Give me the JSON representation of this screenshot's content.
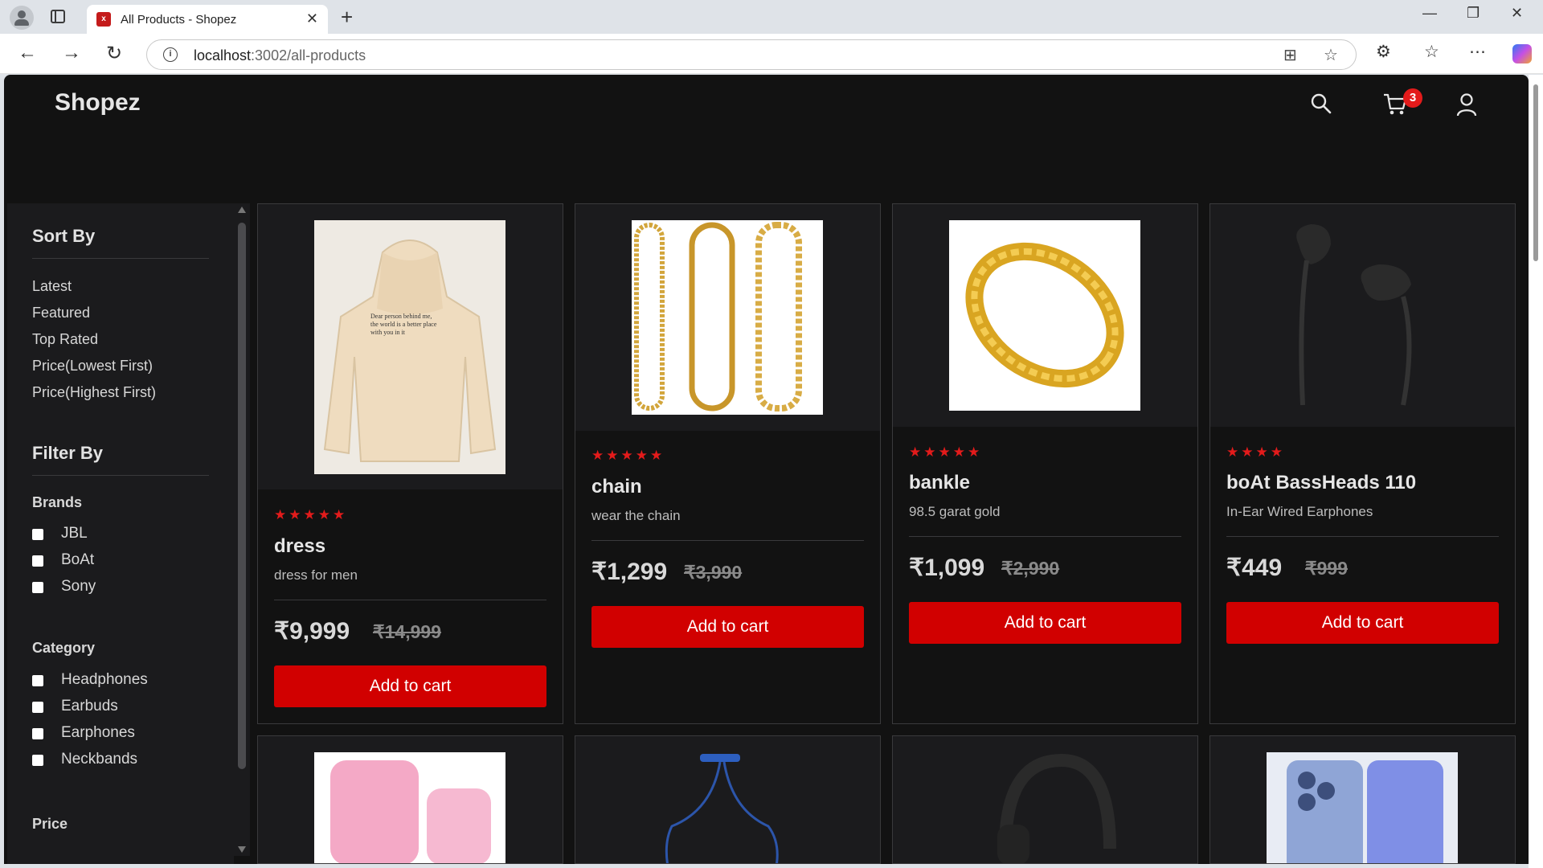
{
  "browser": {
    "tab_title": "All Products - Shopez",
    "url_host": "localhost",
    "url_path": ":3002/all-products"
  },
  "site": {
    "brand": "Shopez",
    "cart_count": "3"
  },
  "sidebar": {
    "sort_heading": "Sort By",
    "sort_options": [
      "Latest",
      "Featured",
      "Top Rated",
      "Price(Lowest First)",
      "Price(Highest First)"
    ],
    "filter_heading": "Filter By",
    "brands_heading": "Brands",
    "brands": [
      "JBL",
      "BoAt",
      "Sony"
    ],
    "category_heading": "Category",
    "categories": [
      "Headphones",
      "Earbuds",
      "Earphones",
      "Neckbands"
    ],
    "price_heading": "Price"
  },
  "products": [
    {
      "stars": "★★★★★",
      "name": "dress",
      "desc": "dress for men",
      "price": "₹9,999",
      "mrp": "₹14,999",
      "button": "Add to cart"
    },
    {
      "stars": "★★★★★",
      "name": "chain",
      "desc": "wear the chain",
      "price": "₹1,299",
      "mrp": "₹3,990",
      "button": "Add to cart"
    },
    {
      "stars": "★★★★★",
      "name": "bankle",
      "desc": "98.5 garat gold",
      "price": "₹1,099",
      "mrp": "₹2,990",
      "button": "Add to cart"
    },
    {
      "stars": "★★★★",
      "name": "boAt BassHeads 110",
      "desc": "In-Ear Wired Earphones",
      "price": "₹449",
      "mrp": "₹999",
      "button": "Add to cart"
    }
  ],
  "hoodie_print": "Dear person behind me, the world is a better place with you in it",
  "theme": {
    "accent": "#d10000",
    "star": "#e31b1b",
    "bg": "#121212"
  }
}
